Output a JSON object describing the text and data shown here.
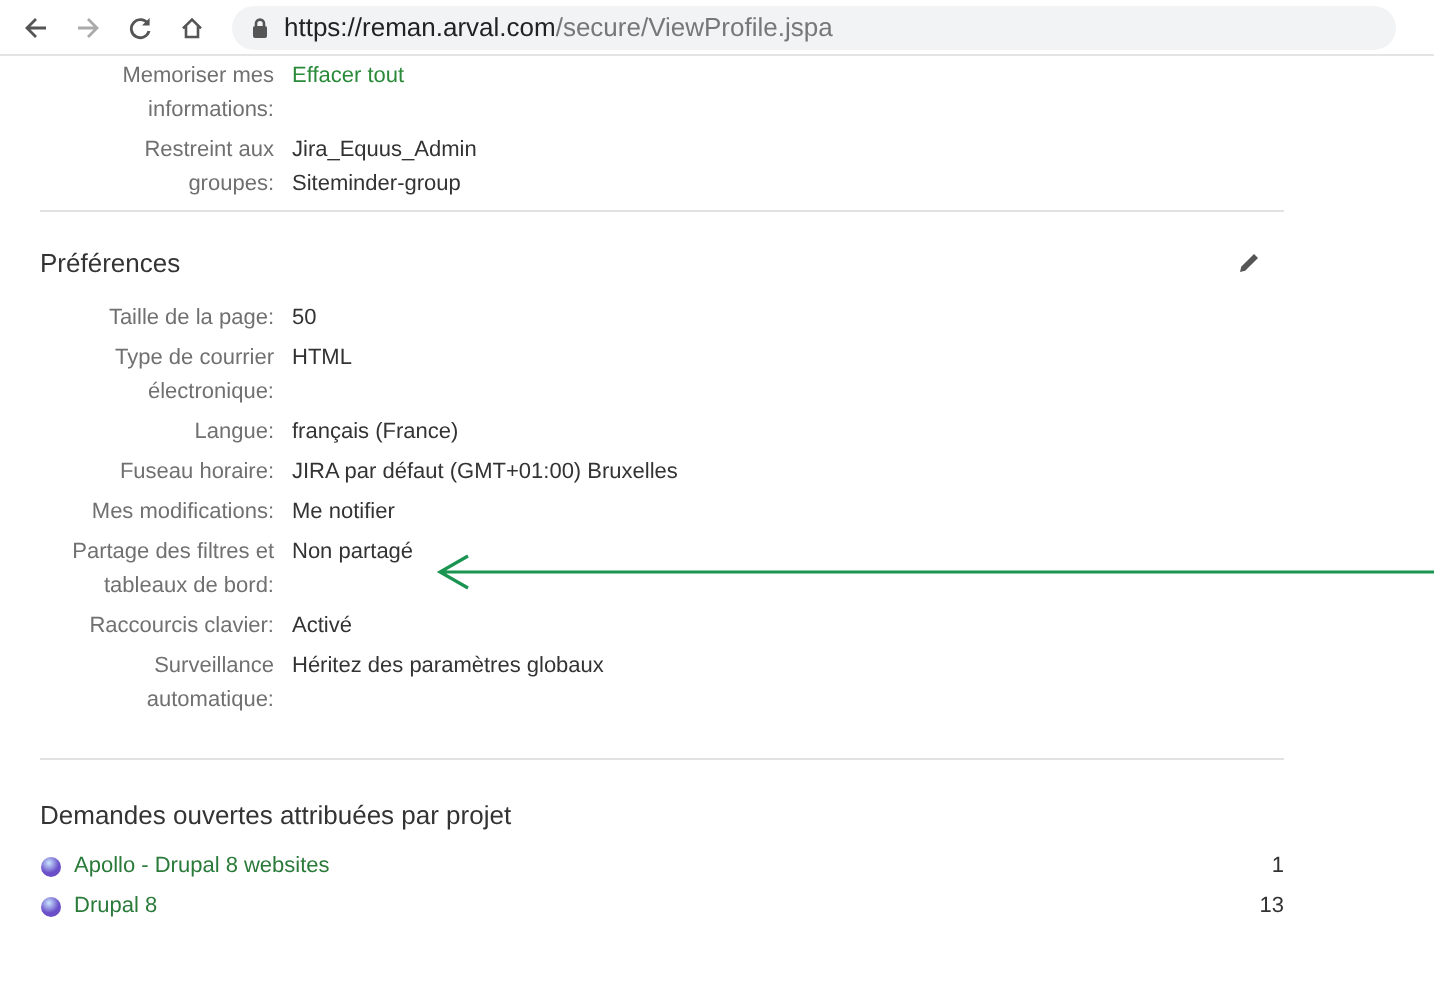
{
  "browser": {
    "url_host": "https://reman.arval.com",
    "url_path": "/secure/ViewProfile.jspa"
  },
  "top_rows": [
    {
      "label": "Memoriser mes informations:",
      "value": "Effacer tout",
      "kind": "link"
    },
    {
      "label": "Restreint aux groupes:",
      "value": "Jira_Equus_Admin\nSiteminder-group",
      "kind": "text"
    }
  ],
  "preferences": {
    "title": "Préférences",
    "rows": [
      {
        "label": "Taille de la page:",
        "value": "50"
      },
      {
        "label": "Type de courrier électronique:",
        "value": "HTML"
      },
      {
        "label": "Langue:",
        "value": "français (France)"
      },
      {
        "label": "Fuseau horaire:",
        "value": "JIRA par défaut (GMT+01:00) Bruxelles"
      },
      {
        "label": "Mes modifications:",
        "value": "Me notifier"
      },
      {
        "label": "Partage des filtres et tableaux de bord:",
        "value": "Non partagé"
      },
      {
        "label": "Raccourcis clavier:",
        "value": "Activé"
      },
      {
        "label": "Surveillance automatique:",
        "value": "Héritez des paramètres globaux"
      }
    ]
  },
  "open_issues": {
    "title": "Demandes ouvertes attribuées par projet",
    "projects": [
      {
        "name": "Apollo - Drupal 8 websites",
        "count": "1"
      },
      {
        "name": "Drupal 8",
        "count": "13"
      }
    ]
  }
}
